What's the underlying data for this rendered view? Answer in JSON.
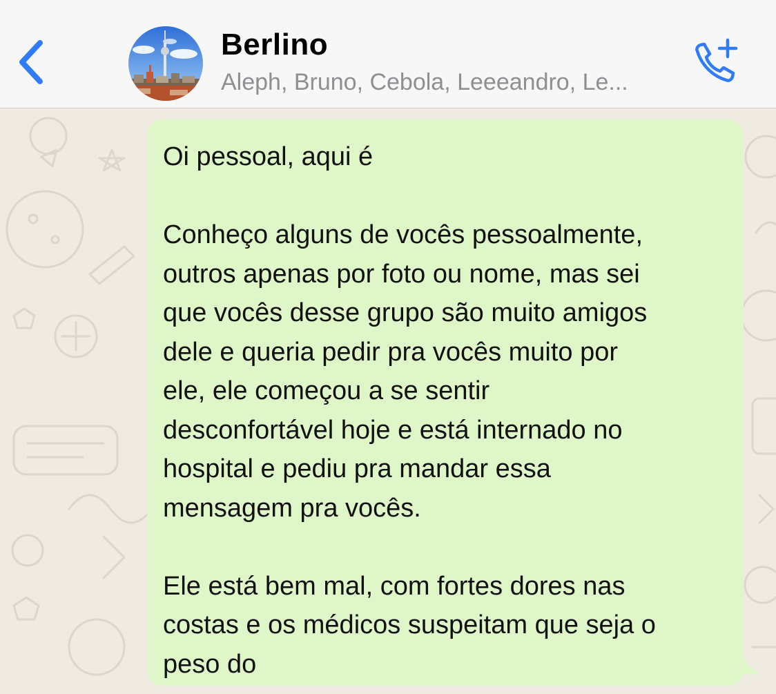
{
  "header": {
    "title": "Berlino",
    "subtitle": "Aleph, Bruno, Cebola, Leeeandro, Le...",
    "accent_color": "#2f7cf6",
    "back_icon": "chevron-left-icon",
    "call_icon": "phone-add-icon",
    "avatar": "group-photo-berlin-tv-tower"
  },
  "message": {
    "bubble_color": "#dff6c9",
    "paragraphs": [
      "Oi pessoal, aqui é",
      "Conheço alguns de vocês pessoalmente,\noutros apenas por foto ou nome, mas sei\nque vocês desse grupo são muito amigos\ndele e queria pedir pra vocês muito por\nele, ele começou a se sentir\ndesconfortável hoje e está internado no\nhospital e pediu pra mandar essa\nmensagem pra vocês.",
      "Ele está bem mal, com fortes dores nas\ncostas e os médicos suspeitam que seja o\npeso do"
    ]
  }
}
